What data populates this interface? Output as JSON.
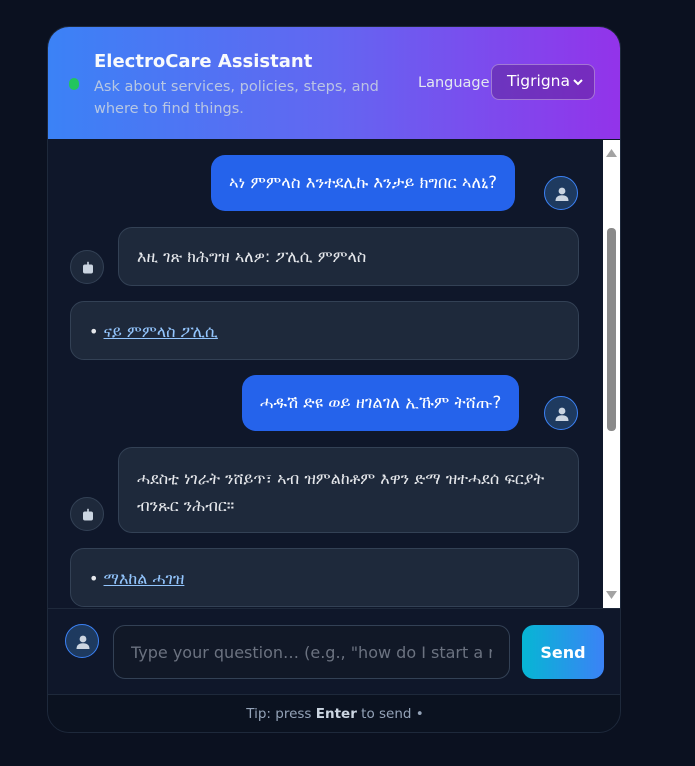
{
  "header": {
    "title": "ElectroCare Assistant",
    "subtitle": "Ask about services, policies, steps, and where to find things.",
    "language_label": "Language",
    "language_value": "Tigrigna",
    "status_color": "#22c55e"
  },
  "messages": [
    {
      "role": "user",
      "text": "ኣነ ምምላስ እንተደሊኩ እንታይ ክግበር ኣለኒ?"
    },
    {
      "role": "bot",
      "text": "እዚ ገጽ ክሕግዝ ኣለዎ: ፖሊሲ ምምላስ"
    },
    {
      "role": "bot-link",
      "bullet": "•",
      "link_text": "ናይ ምምላስ ፖሊሲ"
    },
    {
      "role": "user",
      "text": "ሓዱሽ ድዩ ወይ ዘገልገለ ኢኹም ትሸጡ?"
    },
    {
      "role": "bot",
      "text": "ሓደስቲ ነገራት ንሸይጥ፣ ኣብ ዝምልከቶም እዋን ድማ ዝተሓደሰ ፍርያት ብንጹር ንሕብር።"
    },
    {
      "role": "bot-link",
      "bullet": "•",
      "link_text": "ማእከል ሓገዝ"
    }
  ],
  "input": {
    "placeholder": "Type your question… (e.g., \"how do I start a return\")",
    "value": "",
    "send_label": "Send"
  },
  "footer": {
    "tip_prefix": "Tip: press ",
    "tip_key": "Enter",
    "tip_suffix": " to send •"
  },
  "icons": {
    "user_avatar": "user-icon",
    "bot_avatar": "bot-icon",
    "scroll_up": "triangle-up-icon",
    "scroll_down": "triangle-down-icon",
    "language_caret": "chevron-down-icon"
  }
}
